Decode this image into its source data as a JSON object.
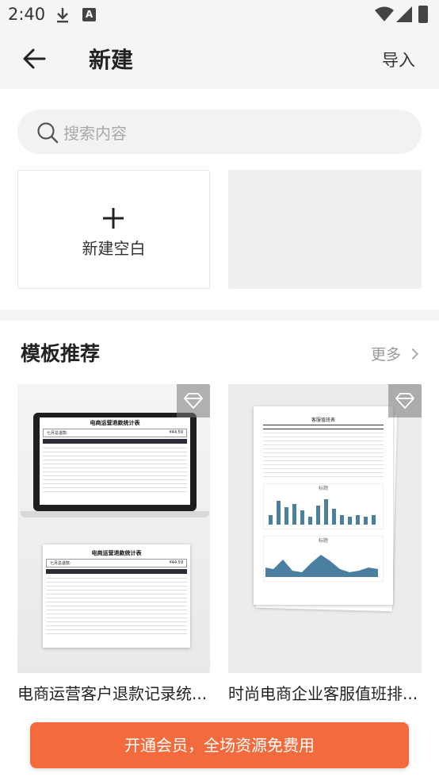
{
  "status_bar": {
    "time": "2:40",
    "icons": [
      "download-icon",
      "font-a-icon",
      "wifi-icon",
      "signal-icon",
      "battery-icon"
    ]
  },
  "header": {
    "back_icon": "arrow-left-icon",
    "title": "新建",
    "import_label": "导入"
  },
  "search": {
    "icon": "search-icon",
    "placeholder": "搜索内容"
  },
  "create": {
    "blank_icon": "plus-icon",
    "blank_label": "新建空白"
  },
  "recommend": {
    "title": "模板推荐",
    "more_label": "更多",
    "templates": [
      {
        "name": "电商运营客户退款记录统...",
        "thumb_title": "电商运营退款统计表",
        "thumb_subtitle_left": "七月总退款:",
        "thumb_subtitle_value": "¥44.59",
        "badge_icon": "diamond-icon"
      },
      {
        "name": "时尚电商企业客服值班排...",
        "thumb_title": "客服值班表",
        "chart_title_1": "标题",
        "chart_title_2": "标题",
        "badge_icon": "diamond-icon"
      }
    ]
  },
  "bottom": {
    "vip_label": "开通会员，全场资源免费用"
  },
  "colors": {
    "accent": "#f36b3d",
    "background": "#f5f5f5",
    "chart_blue": "#4a7fa0"
  }
}
